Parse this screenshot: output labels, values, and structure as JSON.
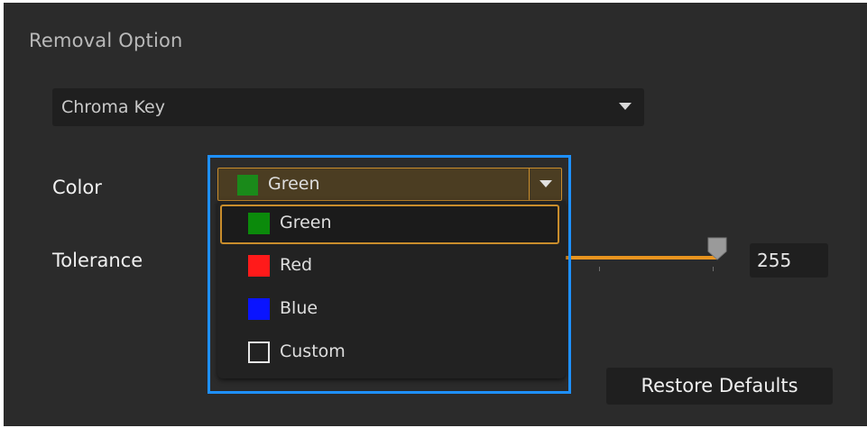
{
  "panel": {
    "section_title": "Removal Option"
  },
  "method_select": {
    "value": "Chroma Key"
  },
  "color": {
    "label": "Color",
    "selected_value": "Green",
    "selected_swatch": "#1a8a1a",
    "options": [
      {
        "label": "Green",
        "swatch": "#0b8a0b",
        "selected": true
      },
      {
        "label": "Red",
        "swatch": "#ff1a1a",
        "selected": false
      },
      {
        "label": "Blue",
        "swatch": "#0a14ff",
        "selected": false
      },
      {
        "label": "Custom",
        "swatch": "none",
        "selected": false
      }
    ]
  },
  "tolerance": {
    "label": "Tolerance",
    "value": "255",
    "slider_fraction": 1.0
  },
  "buttons": {
    "restore_defaults": "Restore Defaults"
  },
  "colors": {
    "accent": "#e8941f",
    "highlight_border": "#1e90ff",
    "panel_bg": "#2b2b2b"
  }
}
